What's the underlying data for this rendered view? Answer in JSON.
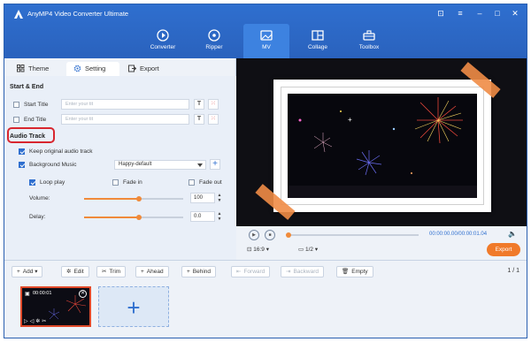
{
  "app": {
    "title": "AnyMP4 Video Converter Ultimate"
  },
  "nav": [
    {
      "label": "Converter"
    },
    {
      "label": "Ripper"
    },
    {
      "label": "MV"
    },
    {
      "label": "Collage"
    },
    {
      "label": "Toolbox"
    }
  ],
  "tabs": {
    "theme": "Theme",
    "setting": "Setting",
    "export": "Export"
  },
  "start_end": {
    "heading": "Start & End",
    "start_title_label": "Start Title",
    "start_title_placeholder": "Enter your tit",
    "end_title_label": "End Title",
    "end_title_placeholder": "Enter your tit"
  },
  "audio": {
    "heading": "Audio Track",
    "keep_original": "Keep original audio track",
    "background_music": "Background Music",
    "music_selected": "Happy-default",
    "loop_play": "Loop play",
    "fade_in": "Fade in",
    "fade_out": "Fade out",
    "volume_label": "Volume:",
    "volume_value": "100",
    "volume_level": 0.55,
    "delay_label": "Delay:",
    "delay_value": "0.0",
    "delay_level": 0.55
  },
  "player": {
    "time": "00:00:00.00/00:00:01.04",
    "aspect": "16:9",
    "page": "1/2",
    "export": "Export"
  },
  "toolbar": {
    "add": "Add",
    "edit": "Edit",
    "trim": "Trim",
    "ahead": "Ahead",
    "behind": "Behind",
    "forward": "Forward",
    "backward": "Backward",
    "empty": "Empty",
    "pager": "1 / 1"
  },
  "clip": {
    "duration": "00:00:01"
  },
  "colors": {
    "accent": "#2f6fcf",
    "orange": "#f07a2a",
    "highlight": "#d8262f"
  }
}
